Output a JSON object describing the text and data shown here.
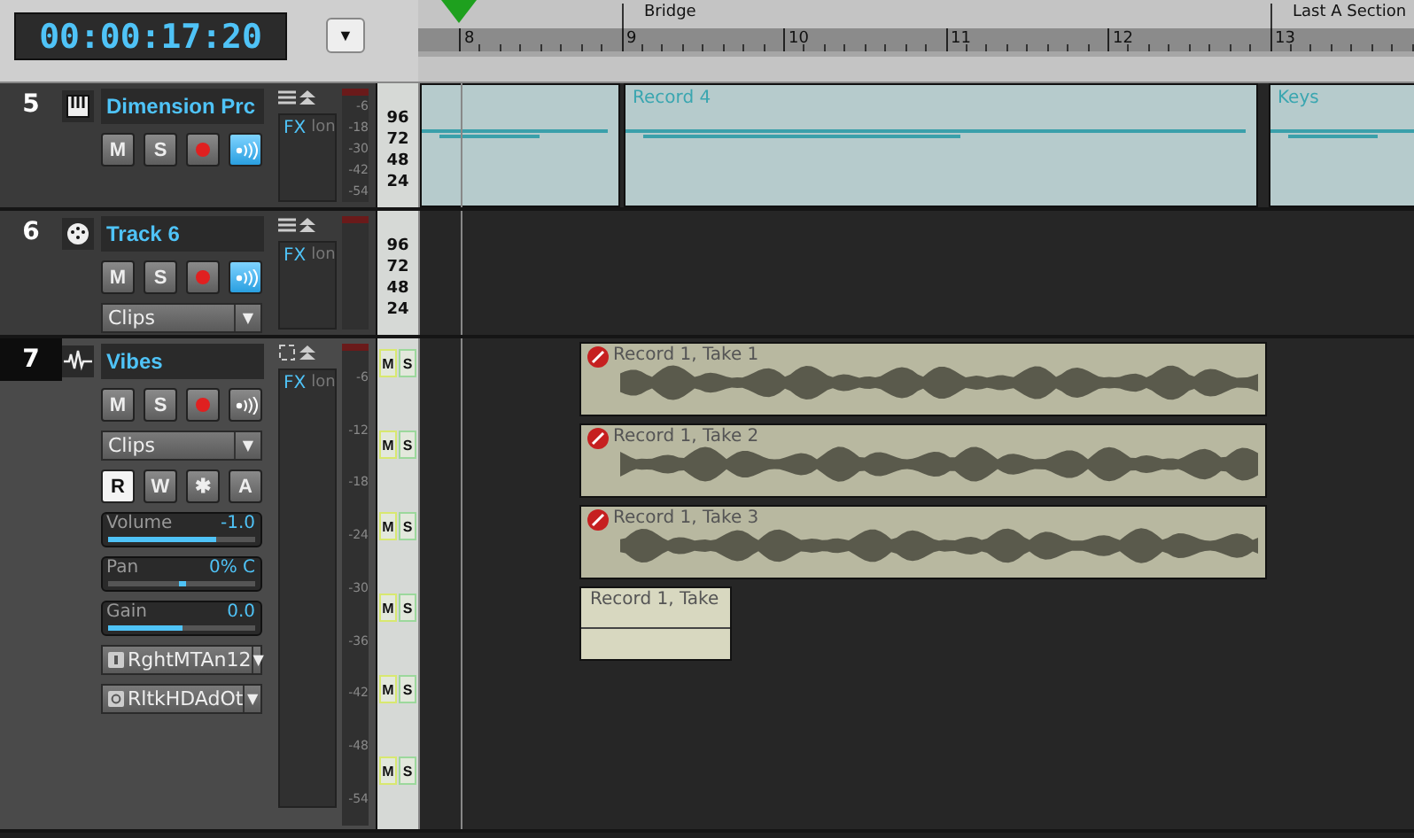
{
  "transport": {
    "time": "00:00:17:20",
    "menu_caret": "▼"
  },
  "ruler": {
    "markers": [
      {
        "label": "Bridge"
      },
      {
        "label": "Last A Section"
      }
    ],
    "bars": [
      "8",
      "9",
      "10",
      "11",
      "12",
      "13"
    ]
  },
  "tracks": [
    {
      "number": "5",
      "kind": "midi",
      "name": "Dimension Prc",
      "selected": false,
      "mute": "M",
      "solo": "S",
      "monitor_on": true,
      "fx": "FX",
      "fx_extra": "lon",
      "meter_scale": [
        "-6",
        "-18",
        "-30",
        "-42",
        "-54"
      ],
      "note_scale": [
        "96",
        "72",
        "48",
        "24"
      ],
      "items": [
        {
          "kind": "notes"
        },
        {
          "kind": "notes",
          "label": "Record 4"
        },
        {
          "kind": "notes",
          "label": "Keys"
        }
      ]
    },
    {
      "number": "6",
      "kind": "drum",
      "name": "Track 6",
      "selected": false,
      "mute": "M",
      "solo": "S",
      "monitor_on": true,
      "fx": "FX",
      "fx_extra": "lon",
      "mode": {
        "label": "Clips",
        "caret": "▼"
      },
      "note_scale": [
        "96",
        "72",
        "48",
        "24"
      ]
    },
    {
      "number": "7",
      "kind": "audio",
      "name": "Vibes",
      "selected": true,
      "mute": "M",
      "solo": "S",
      "monitor_on": false,
      "fx": "FX",
      "fx_extra": "lon",
      "mode": {
        "label": "Clips",
        "caret": "▼"
      },
      "automation": [
        {
          "label": "R",
          "selected": true
        },
        {
          "label": "W",
          "selected": false
        },
        {
          "label": "✱",
          "selected": false
        },
        {
          "label": "A",
          "selected": false
        }
      ],
      "sliders": [
        {
          "label": "Volume",
          "reading": "-1.0",
          "kind": "fill",
          "level": 0.74
        },
        {
          "label": "Pan",
          "reading": "0% C",
          "kind": "center",
          "level": 0.5
        },
        {
          "label": "Gain",
          "reading": "0.0",
          "kind": "fill",
          "level": 0.5
        }
      ],
      "io": [
        {
          "kind": "input",
          "label": "RghtMTAn12",
          "caret": "▼"
        },
        {
          "kind": "output",
          "label": "RltkHDAdOt",
          "caret": "▼"
        }
      ],
      "meter_scale": [
        "-6",
        "-12",
        "-18",
        "-24",
        "-30",
        "-36",
        "-42",
        "-48",
        "-54"
      ],
      "lanes": [
        {
          "mute": "M",
          "solo": "S",
          "take": {
            "label": "Record 1, Take 1",
            "muted": true
          }
        },
        {
          "mute": "M",
          "solo": "S",
          "take": {
            "label": "Record 1, Take 2",
            "muted": true
          }
        },
        {
          "mute": "M",
          "solo": "S",
          "take": {
            "label": "Record 1, Take 3",
            "muted": true
          }
        },
        {
          "mute": "M",
          "solo": "S",
          "take": {
            "label": "Record 1, Take",
            "muted": false
          }
        },
        {
          "mute": "M",
          "solo": "S"
        },
        {
          "mute": "M",
          "solo": "S"
        }
      ]
    }
  ]
}
